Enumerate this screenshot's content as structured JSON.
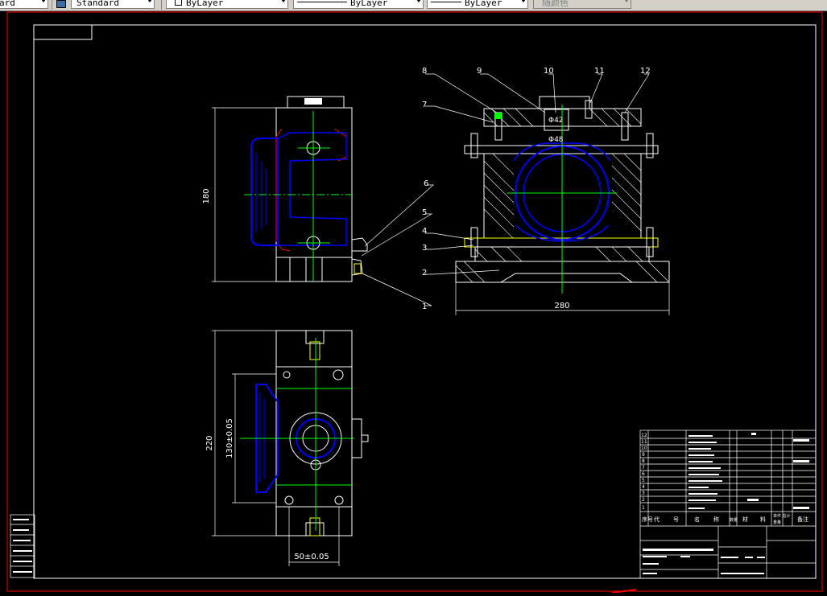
{
  "toolbar": {
    "dimstyle_value": "ard",
    "textstyle_value": "Standard",
    "layer_value": "ByLayer",
    "linetype_value": "ByLayer",
    "lineweight_value": "ByLayer",
    "plotstyle_value": "随颜色"
  },
  "drawing": {
    "balloons": [
      "8",
      "9",
      "10",
      "11",
      "12",
      "7",
      "6",
      "5",
      "4",
      "3",
      "2",
      "1"
    ],
    "dimensions": {
      "height_left": "180",
      "width_front": "280",
      "bore_1": "Φ42",
      "bore_2": "Φ48",
      "length_plan": "220",
      "span_plan": "130±0.05",
      "width_plan": "50±0.05"
    },
    "title_block": {
      "header_cols": [
        "序号",
        "代",
        "号",
        "名",
        "称",
        "数量",
        "材",
        "料",
        "单件 总计",
        "重量",
        "备注"
      ],
      "part_numbers": [
        "12",
        "11",
        "10",
        "9",
        "8",
        "7",
        "6",
        "5",
        "4",
        "3",
        "2",
        "1"
      ]
    }
  },
  "colors": {
    "background": "#000000",
    "frame": "#ffffff",
    "border": "#ff0000",
    "part": "#0000ff",
    "center": "#00ff00",
    "leader": "#ffff00"
  }
}
